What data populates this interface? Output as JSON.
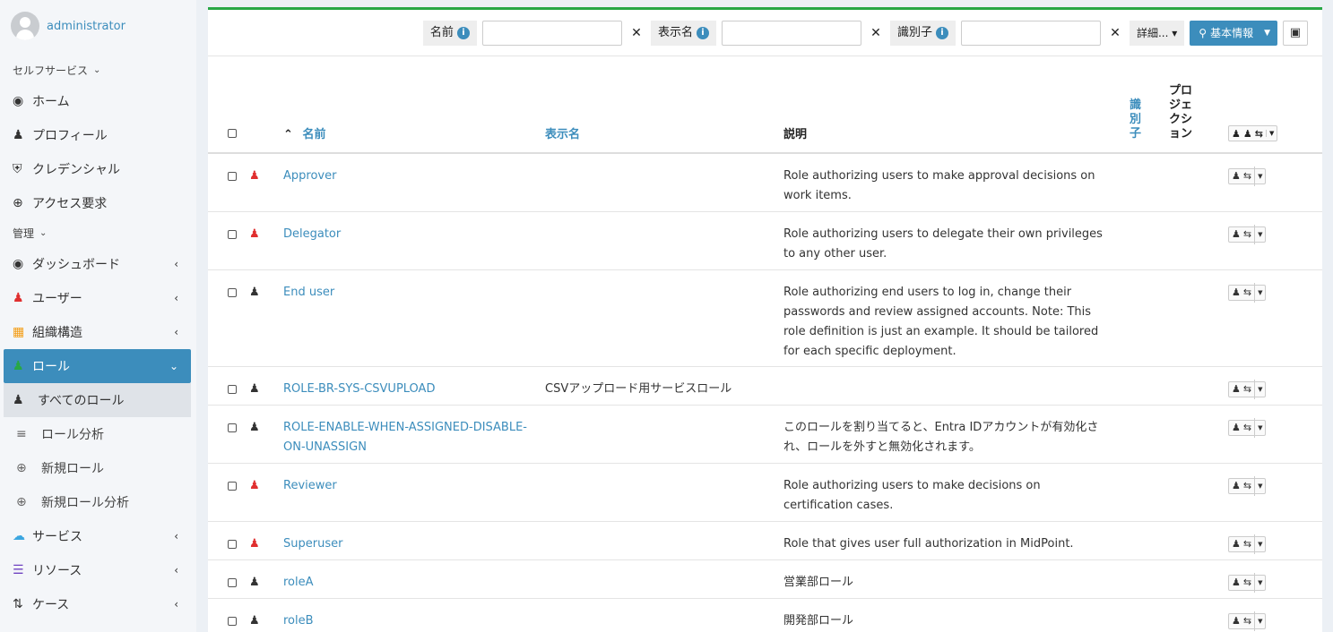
{
  "user": {
    "name": "administrator"
  },
  "sidebar": {
    "sections": [
      {
        "title": "セルフサービス",
        "items": [
          {
            "label": "ホーム",
            "icon": "dashboard-icon"
          },
          {
            "label": "プロフィール",
            "icon": "user-icon"
          },
          {
            "label": "クレデンシャル",
            "icon": "shield-icon"
          },
          {
            "label": "アクセス要求",
            "icon": "plus-circle-icon"
          }
        ]
      },
      {
        "title": "管理",
        "items": [
          {
            "label": "ダッシュボード",
            "icon": "dashboard-icon"
          },
          {
            "label": "ユーザー",
            "icon": "user-icon"
          },
          {
            "label": "組織構造",
            "icon": "building-icon"
          },
          {
            "label": "ロール",
            "icon": "role-icon"
          },
          {
            "label": "すべてのロール",
            "icon": "role-icon"
          },
          {
            "label": "ロール分析",
            "icon": "chart-icon"
          },
          {
            "label": "新規ロール",
            "icon": "plus-circle-icon"
          },
          {
            "label": "新規ロール分析",
            "icon": "plus-circle-icon"
          },
          {
            "label": "サービス",
            "icon": "cloud-icon"
          },
          {
            "label": "リソース",
            "icon": "database-icon"
          },
          {
            "label": "ケース",
            "icon": "cases-icon"
          }
        ]
      }
    ]
  },
  "toolbar": {
    "filters": [
      {
        "label": "名前",
        "value": ""
      },
      {
        "label": "表示名",
        "value": ""
      },
      {
        "label": "識別子",
        "value": ""
      }
    ],
    "more_label": "詳細...",
    "search_label": "基本情報"
  },
  "table": {
    "headers": {
      "name": "名前",
      "display_name": "表示名",
      "description": "説明",
      "identifier": [
        "識",
        "別",
        "子"
      ],
      "projection": [
        "プロ",
        "ジェ",
        "クシ",
        "ョン"
      ]
    },
    "rows": [
      {
        "name": "Approver",
        "display_name": "",
        "description": "Role authorizing users to make approval decisions on work items.",
        "icon_color": "red"
      },
      {
        "name": "Delegator",
        "display_name": "",
        "description": "Role authorizing users to delegate their own privileges to any other user.",
        "icon_color": "red"
      },
      {
        "name": "End user",
        "display_name": "",
        "description": "Role authorizing end users to log in, change their passwords and review assigned accounts. Note: This role definition is just an example. It should be tailored for each specific deployment.",
        "icon_color": "dark"
      },
      {
        "name": "ROLE-BR-SYS-CSVUPLOAD",
        "display_name": "CSVアップロード用サービスロール",
        "description": "",
        "icon_color": "dark"
      },
      {
        "name": "ROLE-ENABLE-WHEN-ASSIGNED-DISABLE-ON-UNASSIGN",
        "display_name": "",
        "description": "このロールを割り当てると、Entra IDアカウントが有効化され、ロールを外すと無効化されます。",
        "icon_color": "dark"
      },
      {
        "name": "Reviewer",
        "display_name": "",
        "description": "Role authorizing users to make decisions on certification cases.",
        "icon_color": "red"
      },
      {
        "name": "Superuser",
        "display_name": "",
        "description": "Role that gives user full authorization in MidPoint.",
        "icon_color": "red"
      },
      {
        "name": "roleA",
        "display_name": "",
        "description": "営業部ロール",
        "icon_color": "dark"
      },
      {
        "name": "roleB",
        "display_name": "",
        "description": "開発部ロール",
        "icon_color": "dark"
      }
    ]
  },
  "colors": {
    "primary": "#3c8dbc",
    "accent_top": "#28a745",
    "role_red": "#e02f2f"
  }
}
